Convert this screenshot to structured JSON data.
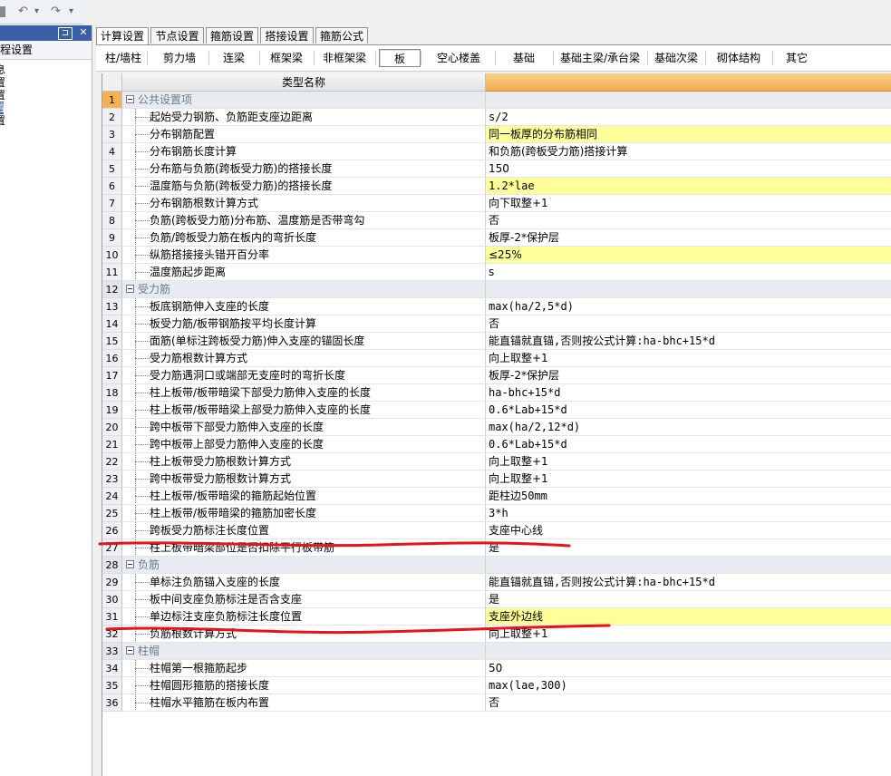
{
  "quick_toolbar": {
    "undo_glyph": "↶",
    "redo_glyph": "↷",
    "dropdown_glyph": "▾"
  },
  "left_pane": {
    "pin_glyph": "⊐",
    "close_glyph": "✕",
    "title": "程设置",
    "tree_items": [
      "息",
      "置",
      "置",
      "置",
      "置"
    ]
  },
  "tabs": [
    "计算设置",
    "节点设置",
    "箍筋设置",
    "搭接设置",
    "箍筋公式"
  ],
  "categories": [
    "柱/墙柱",
    "剪力墙",
    "连梁",
    "框架梁",
    "非框架梁",
    "板",
    "空心楼盖",
    "基础",
    "基础主梁/承台梁",
    "基础次梁",
    "砌体结构",
    "其它"
  ],
  "grid": {
    "header_name": "类型名称",
    "header_value": "",
    "rows": [
      {
        "num": "1",
        "name": "公共设置项",
        "value": "",
        "group": true
      },
      {
        "num": "2",
        "name": "起始受力钢筋、负筋距支座边距离",
        "value": "s/2"
      },
      {
        "num": "3",
        "name": "分布钢筋配置",
        "value": "同一板厚的分布筋相同",
        "hl": true
      },
      {
        "num": "4",
        "name": "分布钢筋长度计算",
        "value": "和负筋(跨板受力筋)搭接计算"
      },
      {
        "num": "5",
        "name": "分布筋与负筋(跨板受力筋)的搭接长度",
        "value": "150"
      },
      {
        "num": "6",
        "name": "温度筋与负筋(跨板受力筋)的搭接长度",
        "value": "1.2*lae",
        "hl": true
      },
      {
        "num": "7",
        "name": "分布钢筋根数计算方式",
        "value": "向下取整+1"
      },
      {
        "num": "8",
        "name": "负筋(跨板受力筋)分布筋、温度筋是否带弯勾",
        "value": "否"
      },
      {
        "num": "9",
        "name": "负筋/跨板受力筋在板内的弯折长度",
        "value": "板厚-2*保护层"
      },
      {
        "num": "10",
        "name": "纵筋搭接接头错开百分率",
        "value": "≤25%",
        "hl": true
      },
      {
        "num": "11",
        "name": "温度筋起步距离",
        "value": "s"
      },
      {
        "num": "12",
        "name": "受力筋",
        "value": "",
        "group": true
      },
      {
        "num": "13",
        "name": "板底钢筋伸入支座的长度",
        "value": "max(ha/2,5*d)"
      },
      {
        "num": "14",
        "name": "板受力筋/板带钢筋按平均长度计算",
        "value": "否"
      },
      {
        "num": "15",
        "name": "面筋(单标注跨板受力筋)伸入支座的锚固长度",
        "value": "能直锚就直锚,否则按公式计算:ha-bhc+15*d"
      },
      {
        "num": "16",
        "name": "受力筋根数计算方式",
        "value": "向上取整+1"
      },
      {
        "num": "17",
        "name": "受力筋遇洞口或端部无支座时的弯折长度",
        "value": "板厚-2*保护层"
      },
      {
        "num": "18",
        "name": "柱上板带/板带暗梁下部受力筋伸入支座的长度",
        "value": "ha-bhc+15*d"
      },
      {
        "num": "19",
        "name": "柱上板带/板带暗梁上部受力筋伸入支座的长度",
        "value": "0.6*Lab+15*d"
      },
      {
        "num": "20",
        "name": "跨中板带下部受力筋伸入支座的长度",
        "value": "max(ha/2,12*d)"
      },
      {
        "num": "21",
        "name": "跨中板带上部受力筋伸入支座的长度",
        "value": "0.6*Lab+15*d"
      },
      {
        "num": "22",
        "name": "柱上板带受力筋根数计算方式",
        "value": "向上取整+1"
      },
      {
        "num": "23",
        "name": "跨中板带受力筋根数计算方式",
        "value": "向上取整+1"
      },
      {
        "num": "24",
        "name": "柱上板带/板带暗梁的箍筋起始位置",
        "value": "距柱边50mm"
      },
      {
        "num": "25",
        "name": "柱上板带/板带暗梁的箍筋加密长度",
        "value": "3*h"
      },
      {
        "num": "26",
        "name": "跨板受力筋标注长度位置",
        "value": "支座中心线"
      },
      {
        "num": "27",
        "name": "柱上板带暗梁部位是否扣除平行板带筋",
        "value": "是"
      },
      {
        "num": "28",
        "name": "负筋",
        "value": "",
        "group": true
      },
      {
        "num": "29",
        "name": "单标注负筋锚入支座的长度",
        "value": "能直锚就直锚,否则按公式计算:ha-bhc+15*d"
      },
      {
        "num": "30",
        "name": "板中间支座负筋标注是否含支座",
        "value": "是"
      },
      {
        "num": "31",
        "name": "单边标注支座负筋标注长度位置",
        "value": "支座外边线",
        "hl": true
      },
      {
        "num": "32",
        "name": "负筋根数计算方式",
        "value": "向上取整+1"
      },
      {
        "num": "33",
        "name": "柱帽",
        "value": "",
        "group": true
      },
      {
        "num": "34",
        "name": "柱帽第一根箍筋起步",
        "value": "50"
      },
      {
        "num": "35",
        "name": "柱帽圆形箍筋的搭接长度",
        "value": "max(lae,300)"
      },
      {
        "num": "36",
        "name": "柱帽水平箍筋在板内布置",
        "value": "否"
      }
    ]
  },
  "colors": {
    "highlight_row": "#ffff99",
    "header_value": "#f3a94b",
    "annotation": "#e8121b",
    "selection": "#3a5fa9"
  }
}
